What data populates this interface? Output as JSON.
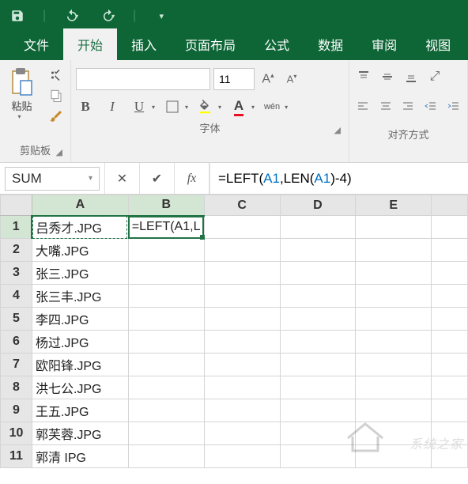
{
  "qat": {
    "save": "save-icon",
    "undo": "undo-icon",
    "redo": "redo-icon"
  },
  "ribbon": {
    "tabs": [
      "文件",
      "开始",
      "插入",
      "页面布局",
      "公式",
      "数据",
      "审阅",
      "视图"
    ],
    "active_tab_index": 1,
    "groups": {
      "clipboard": {
        "label": "剪贴板",
        "paste_label": "粘贴"
      },
      "font": {
        "label": "字体",
        "font_name": "",
        "font_size": "11",
        "bold": "B",
        "italic": "I",
        "underline": "U",
        "wen": "wén"
      },
      "align": {
        "label": "对齐方式"
      }
    }
  },
  "name_box": "SUM",
  "formula_bar": {
    "formula_display": "=LEFT(A1,LEN(A1)-4)",
    "fx_label": "fx"
  },
  "grid": {
    "columns": [
      "A",
      "B",
      "C",
      "D",
      "E"
    ],
    "rows": [
      {
        "n": 1,
        "A": "吕秀才.JPG",
        "B": "=LEFT(A1,L"
      },
      {
        "n": 2,
        "A": "大嘴.JPG",
        "B": ""
      },
      {
        "n": 3,
        "A": "张三.JPG",
        "B": ""
      },
      {
        "n": 4,
        "A": "张三丰.JPG",
        "B": ""
      },
      {
        "n": 5,
        "A": "李四.JPG",
        "B": ""
      },
      {
        "n": 6,
        "A": "杨过.JPG",
        "B": ""
      },
      {
        "n": 7,
        "A": "欧阳锋.JPG",
        "B": ""
      },
      {
        "n": 8,
        "A": "洪七公.JPG",
        "B": ""
      },
      {
        "n": 9,
        "A": "王五.JPG",
        "B": ""
      },
      {
        "n": 10,
        "A": "郭芙蓉.JPG",
        "B": ""
      },
      {
        "n": 11,
        "A": "郭清 IPG",
        "B": ""
      }
    ],
    "active_cell": "B1",
    "referenced_cell": "A1"
  },
  "watermark": "系统之家"
}
